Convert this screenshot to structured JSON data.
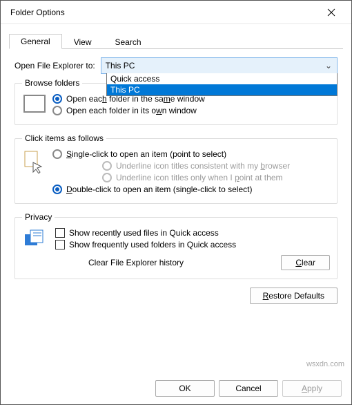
{
  "window": {
    "title": "Folder Options"
  },
  "tabs": {
    "general": "General",
    "view": "View",
    "search": "Search"
  },
  "open_to": {
    "label": "Open File Explorer to:",
    "selected": "This PC",
    "options": {
      "quick": "Quick access",
      "pc": "This PC"
    }
  },
  "browse": {
    "legend": "Browse folders",
    "same": "Open each folder in the same window",
    "own": "Open each folder in its own window"
  },
  "click": {
    "legend": "Click items as follows",
    "single": "Single-click to open an item (point to select)",
    "u_browser": "Underline icon titles consistent with my browser",
    "u_point": "Underline icon titles only when I point at them",
    "double": "Double-click to open an item (single-click to select)"
  },
  "privacy": {
    "legend": "Privacy",
    "recent": "Show recently used files in Quick access",
    "freq": "Show frequently used folders in Quick access",
    "clear_label": "Clear File Explorer history",
    "clear_btn": "Clear"
  },
  "restore": "Restore Defaults",
  "footer": {
    "ok": "OK",
    "cancel": "Cancel",
    "apply": "Apply"
  },
  "watermark": "wsxdn.com"
}
